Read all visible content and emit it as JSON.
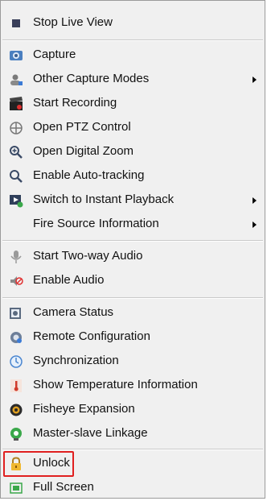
{
  "menu": {
    "items": [
      {
        "label": "Stop Live View",
        "icon": "stop-square-icon"
      },
      {
        "label": "Capture",
        "icon": "camera-icon"
      },
      {
        "label": "Other Capture Modes",
        "icon": "user-capture-icon",
        "submenu": true
      },
      {
        "label": "Start Recording",
        "icon": "clapperboard-icon"
      },
      {
        "label": "Open PTZ Control",
        "icon": "ptz-arrows-icon"
      },
      {
        "label": "Open Digital Zoom",
        "icon": "zoom-in-icon"
      },
      {
        "label": "Enable Auto-tracking",
        "icon": "search-icon"
      },
      {
        "label": "Switch to Instant Playback",
        "icon": "playback-icon",
        "submenu": true
      },
      {
        "label": "Fire Source Information",
        "icon": "",
        "submenu": true
      },
      {
        "label": "Start Two-way Audio",
        "icon": "microphone-icon"
      },
      {
        "label": "Enable Audio",
        "icon": "audio-disabled-icon"
      },
      {
        "label": "Camera Status",
        "icon": "camera-status-icon"
      },
      {
        "label": "Remote Configuration",
        "icon": "remote-config-icon"
      },
      {
        "label": "Synchronization",
        "icon": "sync-clock-icon"
      },
      {
        "label": "Show Temperature Information",
        "icon": "thermometer-icon"
      },
      {
        "label": "Fisheye Expansion",
        "icon": "fisheye-icon"
      },
      {
        "label": "Master-slave Linkage",
        "icon": "linkage-icon"
      },
      {
        "label": "Unlock",
        "icon": "lock-icon"
      },
      {
        "label": "Full Screen",
        "icon": "fullscreen-icon"
      }
    ]
  },
  "colors": {
    "highlight_border": "#e02020",
    "menu_background": "#f0f0f0"
  }
}
